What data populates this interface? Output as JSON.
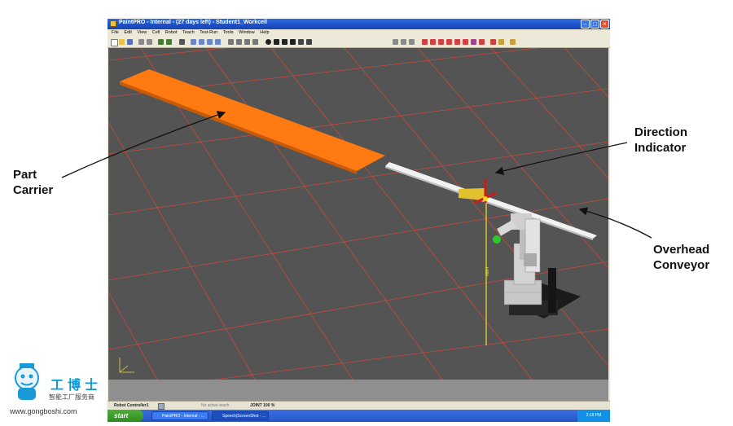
{
  "window": {
    "title": "PaintPRO - Internal - (27 days left) - Student1_Workcell",
    "menu": [
      "File",
      "Edit",
      "View",
      "Cell",
      "Robot",
      "Teach",
      "Test-Run",
      "Tools",
      "Window",
      "Help"
    ]
  },
  "statusbar": {
    "controller": "Robot Controller1",
    "mode": "No active teach",
    "joint": "JOINT  100 %"
  },
  "taskbar": {
    "start": "start",
    "tasks": [
      "PaintPRO - Internal - ...",
      "Speech|ScreenShot - ..."
    ],
    "clock": "2:19 PM"
  },
  "scene": {
    "axis_label": "4664"
  },
  "callouts": {
    "part_carrier": [
      "Part",
      "Carrier"
    ],
    "direction_indicator": [
      "Direction",
      "Indicator"
    ],
    "overhead_conveyor": [
      "Overhead",
      "Conveyor"
    ]
  },
  "watermark": {
    "brand_cn": "工博士",
    "tagline_cn": "智能工厂服务商",
    "url": "www.gongboshi.com"
  },
  "colors": {
    "floor": "#545454",
    "grid": "#c84a3a",
    "part_carrier": "#ff7a10",
    "conveyor": "#f2f2f2",
    "direction_indicator": "#e2c02e"
  }
}
